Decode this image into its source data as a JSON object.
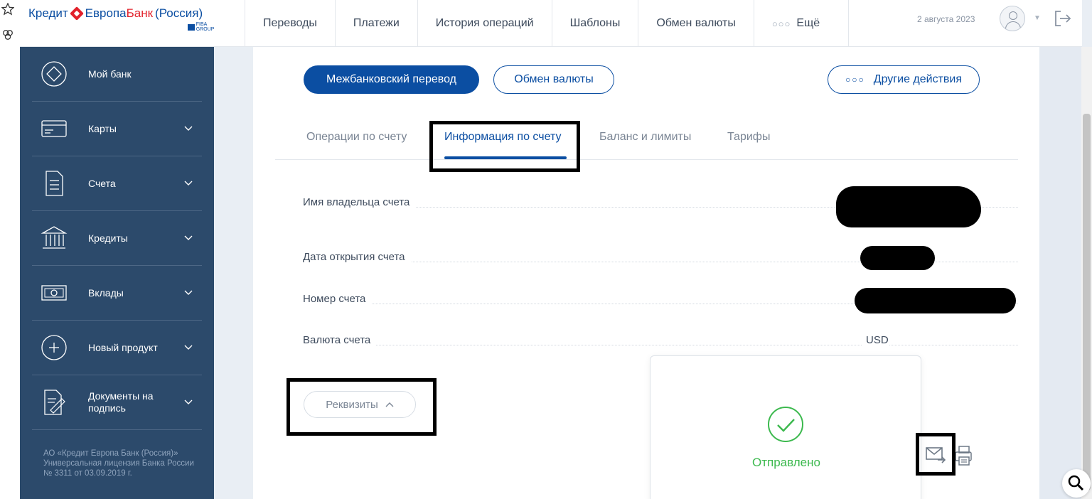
{
  "header": {
    "logo": {
      "part1": "Кредит",
      "part2": "Европа",
      "part3": "Банк",
      "part4": "(Россия)",
      "sub": "FIBA GROUP"
    },
    "nav": [
      "Переводы",
      "Платежи",
      "История операций",
      "Шаблоны",
      "Обмен валюты"
    ],
    "more_label": "Ещё",
    "more_dots": "○○○",
    "date": "2 августа 2023"
  },
  "sidebar": {
    "items": [
      {
        "label": "Мой банк",
        "icon": "diamond-icon"
      },
      {
        "label": "Карты",
        "icon": "card-icon"
      },
      {
        "label": "Счета",
        "icon": "document-icon"
      },
      {
        "label": "Кредиты",
        "icon": "bank-building-icon"
      },
      {
        "label": "Вклады",
        "icon": "banknote-icon"
      },
      {
        "label": "Новый продукт",
        "icon": "plus-circle-icon"
      },
      {
        "label": "Документы на подпись",
        "icon": "sign-document-icon"
      }
    ],
    "footer": "АО «Кредит Европа Банк (Россия)» Универсальная лицензия Банка России № 3311 от 03.09.2019 г."
  },
  "actions": {
    "primary": "Межбанковский перевод",
    "exchange": "Обмен валюты",
    "other": "Другие действия",
    "other_dots": "○○○"
  },
  "tabs": [
    {
      "label": "Операции по счету",
      "active": false
    },
    {
      "label": "Информация по счету",
      "active": true
    },
    {
      "label": "Баланс и лимиты",
      "active": false
    },
    {
      "label": "Тарифы",
      "active": false
    }
  ],
  "info": {
    "owner_label": "Имя владельца счета",
    "open_date_label": "Дата открытия счета",
    "number_label": "Номер счета",
    "currency_label": "Валюта счета",
    "currency_value": "USD"
  },
  "rekvizity_label": "Реквизиты",
  "popup": {
    "status": "Отправлено"
  },
  "colors": {
    "brand_blue": "#0b4ea2",
    "brand_red": "#e2212b",
    "sidebar": "#2c4a6b",
    "success": "#3cb94e"
  }
}
